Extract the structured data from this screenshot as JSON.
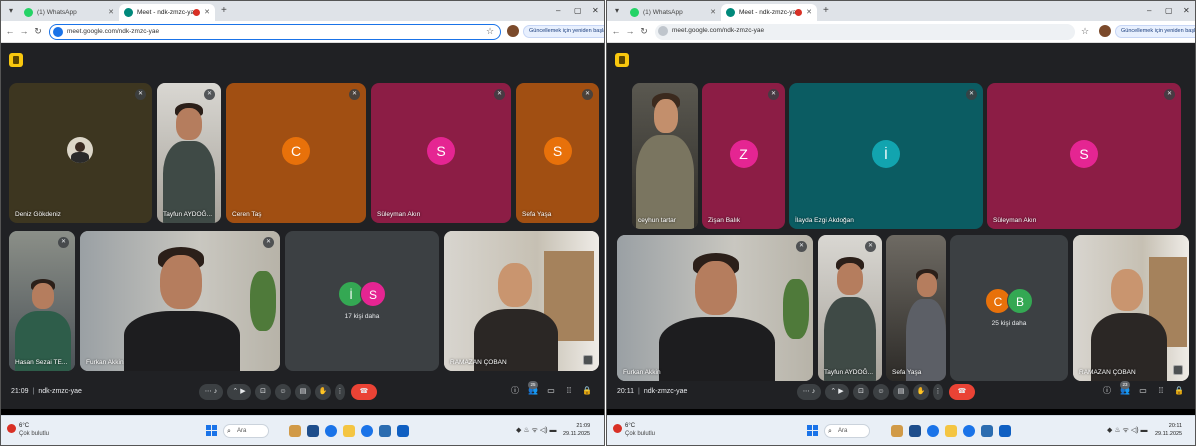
{
  "left_screen": {
    "tabs": [
      {
        "label": "(1) WhatsApp",
        "favicon_color": "#25d366",
        "active": false
      },
      {
        "label": "Meet - ndk-zmzc-yae",
        "favicon_color": "#00897b",
        "active": true
      }
    ],
    "url": "meet.google.com/ndk-zmzc-yae",
    "tiles_row1": [
      {
        "name": "Deniz Gökdeniz",
        "kind": "photo-avatar",
        "bg": "#3d3620"
      },
      {
        "name": "Tayfun AYDOĞ...",
        "kind": "video",
        "bg": "#6d6a63"
      },
      {
        "name": "Ceren Taş",
        "kind": "letter",
        "letter": "C",
        "bg": "#a14f12",
        "avatar_color": "#e8710a"
      },
      {
        "name": "Süleyman Akın",
        "kind": "letter",
        "letter": "S",
        "bg": "#8c1d45",
        "avatar_color": "#e52592"
      },
      {
        "name": "Sefa Yaşa",
        "kind": "letter",
        "letter": "S",
        "bg": "#a14f12",
        "avatar_color": "#e8710a"
      }
    ],
    "tiles_row2": [
      {
        "name": "Hasan Sezai TE...",
        "kind": "video",
        "bg": "#5d6870"
      },
      {
        "name": "Furkan Akkin",
        "kind": "video",
        "bg": "#8a8f93"
      },
      {
        "name": "17 kişi daha",
        "kind": "others",
        "letters": [
          "İ",
          "S"
        ],
        "colors": [
          "#34a853",
          "#e52592"
        ]
      },
      {
        "name": "RAMAZAN ÇOBAN",
        "kind": "video",
        "bg": "#b8b4ac"
      }
    ],
    "time": "21:09",
    "meeting_code": "ndk-zmzc-yae",
    "participants_count": "25",
    "taskbar_clock_time": "21:09",
    "taskbar_clock_date": "29.11.2025"
  },
  "right_screen": {
    "tabs": [
      {
        "label": "(1) WhatsApp",
        "favicon_color": "#25d366",
        "active": false
      },
      {
        "label": "Meet - ndk-zmzc-yae",
        "favicon_color": "#00897b",
        "active": true
      }
    ],
    "url": "meet.google.com/ndk-zmzc-yae",
    "update_label": "Güncellemek için yeniden başlat",
    "tiles_row1": [
      {
        "name": "ceyhun tartar",
        "kind": "video",
        "bg": "#4b4a44"
      },
      {
        "name": "Zişan Balık",
        "kind": "letter",
        "letter": "Z",
        "bg": "#8c1d45",
        "avatar_color": "#e52592"
      },
      {
        "name": "İlayda Ezgi Akdoğan",
        "kind": "letter",
        "letter": "İ",
        "bg": "#0b5c62",
        "avatar_color": "#12a4af"
      },
      {
        "name": "Süleyman Akın",
        "kind": "letter",
        "letter": "S",
        "bg": "#8c1d45",
        "avatar_color": "#e52592"
      }
    ],
    "tiles_row2": [
      {
        "name": "Furkan Akkin",
        "kind": "video",
        "bg": "#8a8f93"
      },
      {
        "name": "Tayfun AYDOĞ...",
        "kind": "video",
        "bg": "#6d6a63"
      },
      {
        "name": "Sefa Yaşa",
        "kind": "video",
        "bg": "#3e3b38"
      },
      {
        "name": "25 kişi daha",
        "kind": "others",
        "letters": [
          "C",
          "B"
        ],
        "colors": [
          "#e8710a",
          "#34a853"
        ]
      },
      {
        "name": "RAMAZAN ÇOBAN",
        "kind": "video",
        "bg": "#b8b4ac"
      }
    ],
    "time": "20:11",
    "meeting_code": "ndk-zmzc-yae",
    "participants_count": "23",
    "taskbar_clock_time": "20:11",
    "taskbar_clock_date": "29.11.2025"
  },
  "common": {
    "weather_temp": "6°C",
    "weather_desc": "Çok bulutlu",
    "search_label": "Ara",
    "icons": {
      "mic": "mic-icon",
      "camera": "camera-icon",
      "present": "present-icon",
      "emoji": "emoji-icon",
      "captions": "captions-icon",
      "hand": "raise-hand-icon",
      "more": "more-vert-icon",
      "hangup": "hangup-icon",
      "info": "info-icon",
      "people": "people-icon",
      "chat": "chat-icon",
      "activities": "activities-icon",
      "host": "host-controls-icon"
    },
    "colors": {
      "meet_bg": "#202124",
      "hangup": "#ea4335",
      "accent": "#1a73e8"
    }
  }
}
